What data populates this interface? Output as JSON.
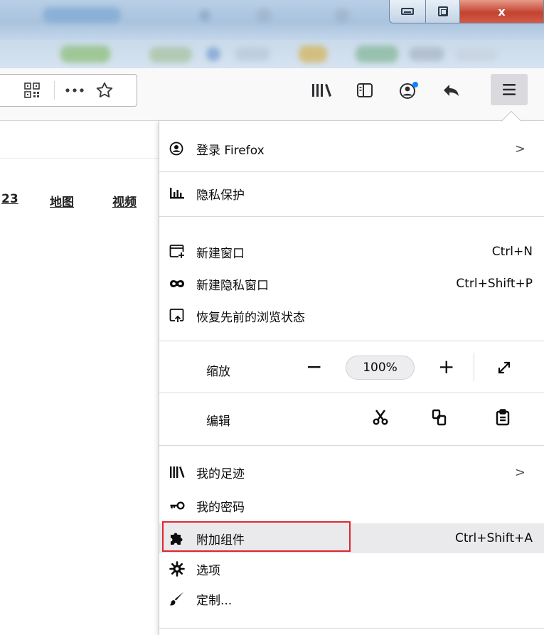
{
  "window": {
    "close_label": "x"
  },
  "toolbar": {
    "urlbar_icons": [
      "qr-code-icon",
      "more-icon",
      "star-icon"
    ],
    "icons": [
      "library-icon",
      "sidebar-icon",
      "account-icon",
      "back-icon",
      "menu-icon"
    ],
    "notification_dot_color": "#0a84ff"
  },
  "page": {
    "links": [
      "23",
      "地图",
      "视频"
    ]
  },
  "menu": {
    "sign_in": {
      "label": "登录 Firefox",
      "arrow": ">"
    },
    "privacy": {
      "label": "隐私保护"
    },
    "new_window": {
      "label": "新建窗口",
      "shortcut": "Ctrl+N"
    },
    "new_private_window": {
      "label": "新建隐私窗口",
      "shortcut": "Ctrl+Shift+P"
    },
    "restore_session": {
      "label": "恢复先前的浏览状态"
    },
    "zoom": {
      "label": "缩放",
      "minus": "−",
      "value": "100%",
      "plus": "+"
    },
    "edit": {
      "label": "编辑"
    },
    "library": {
      "label": "我的足迹",
      "arrow": ">"
    },
    "passwords": {
      "label": "我的密码"
    },
    "addons": {
      "label": "附加组件",
      "shortcut": "Ctrl+Shift+A",
      "highlighted": true
    },
    "options": {
      "label": "选项"
    },
    "customize": {
      "label": "定制..."
    }
  },
  "colors": {
    "highlight_border": "#e0242d",
    "menu_hover": "#eaeaec"
  }
}
